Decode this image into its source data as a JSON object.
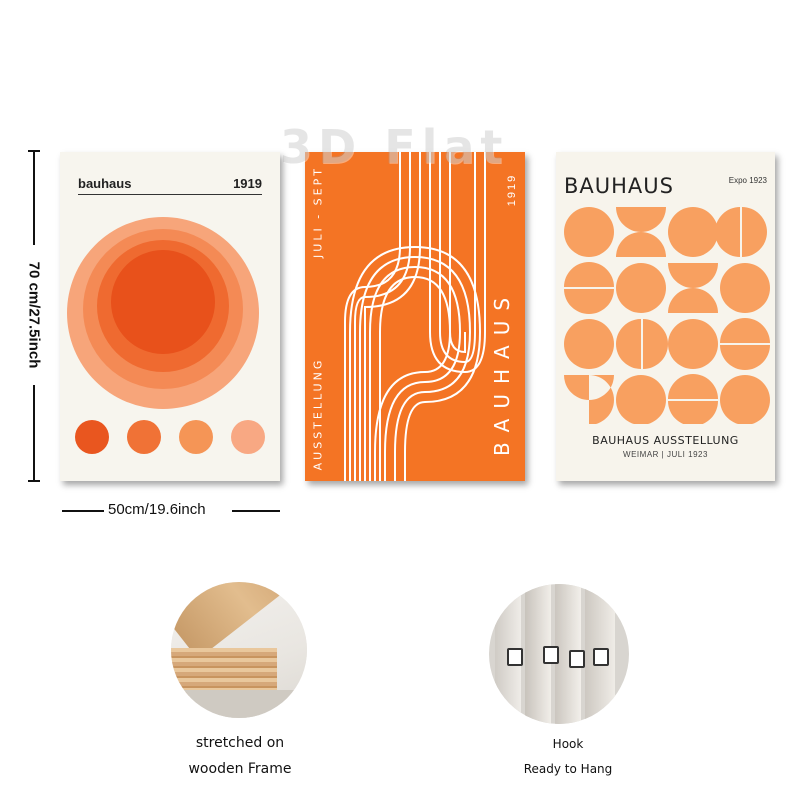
{
  "dimensions": {
    "height_label": "70 cm/27.5inch",
    "width_label": "50cm/19.6inch"
  },
  "watermark": "3D Flat",
  "poster1": {
    "brand": "bauhaus",
    "year": "1919",
    "circle_colors": [
      "#f7a57a",
      "#f48a55",
      "#ef6a30",
      "#e8511b"
    ],
    "dot_colors": [
      "#e9561f",
      "#f07236",
      "#f59556",
      "#f8a883"
    ]
  },
  "poster2": {
    "top_text": "JULI - SEPT",
    "year": "1919",
    "left_text": "AUSSTELLUNG",
    "big_text": "BAUHAUS",
    "bg_color": "#f47424"
  },
  "poster3": {
    "title": "BAUHAUS",
    "expo": "Expo 1923",
    "subtitle": "BAUHAUS AUSSTELLUNG",
    "details": "WEIMAR | JULI 1923",
    "shape_color": "#f8a060"
  },
  "detail1": {
    "caption_line1": "stretched on",
    "caption_line2": "wooden Frame"
  },
  "detail2": {
    "caption_line1": "Hook",
    "caption_line2": "Ready to Hang"
  }
}
